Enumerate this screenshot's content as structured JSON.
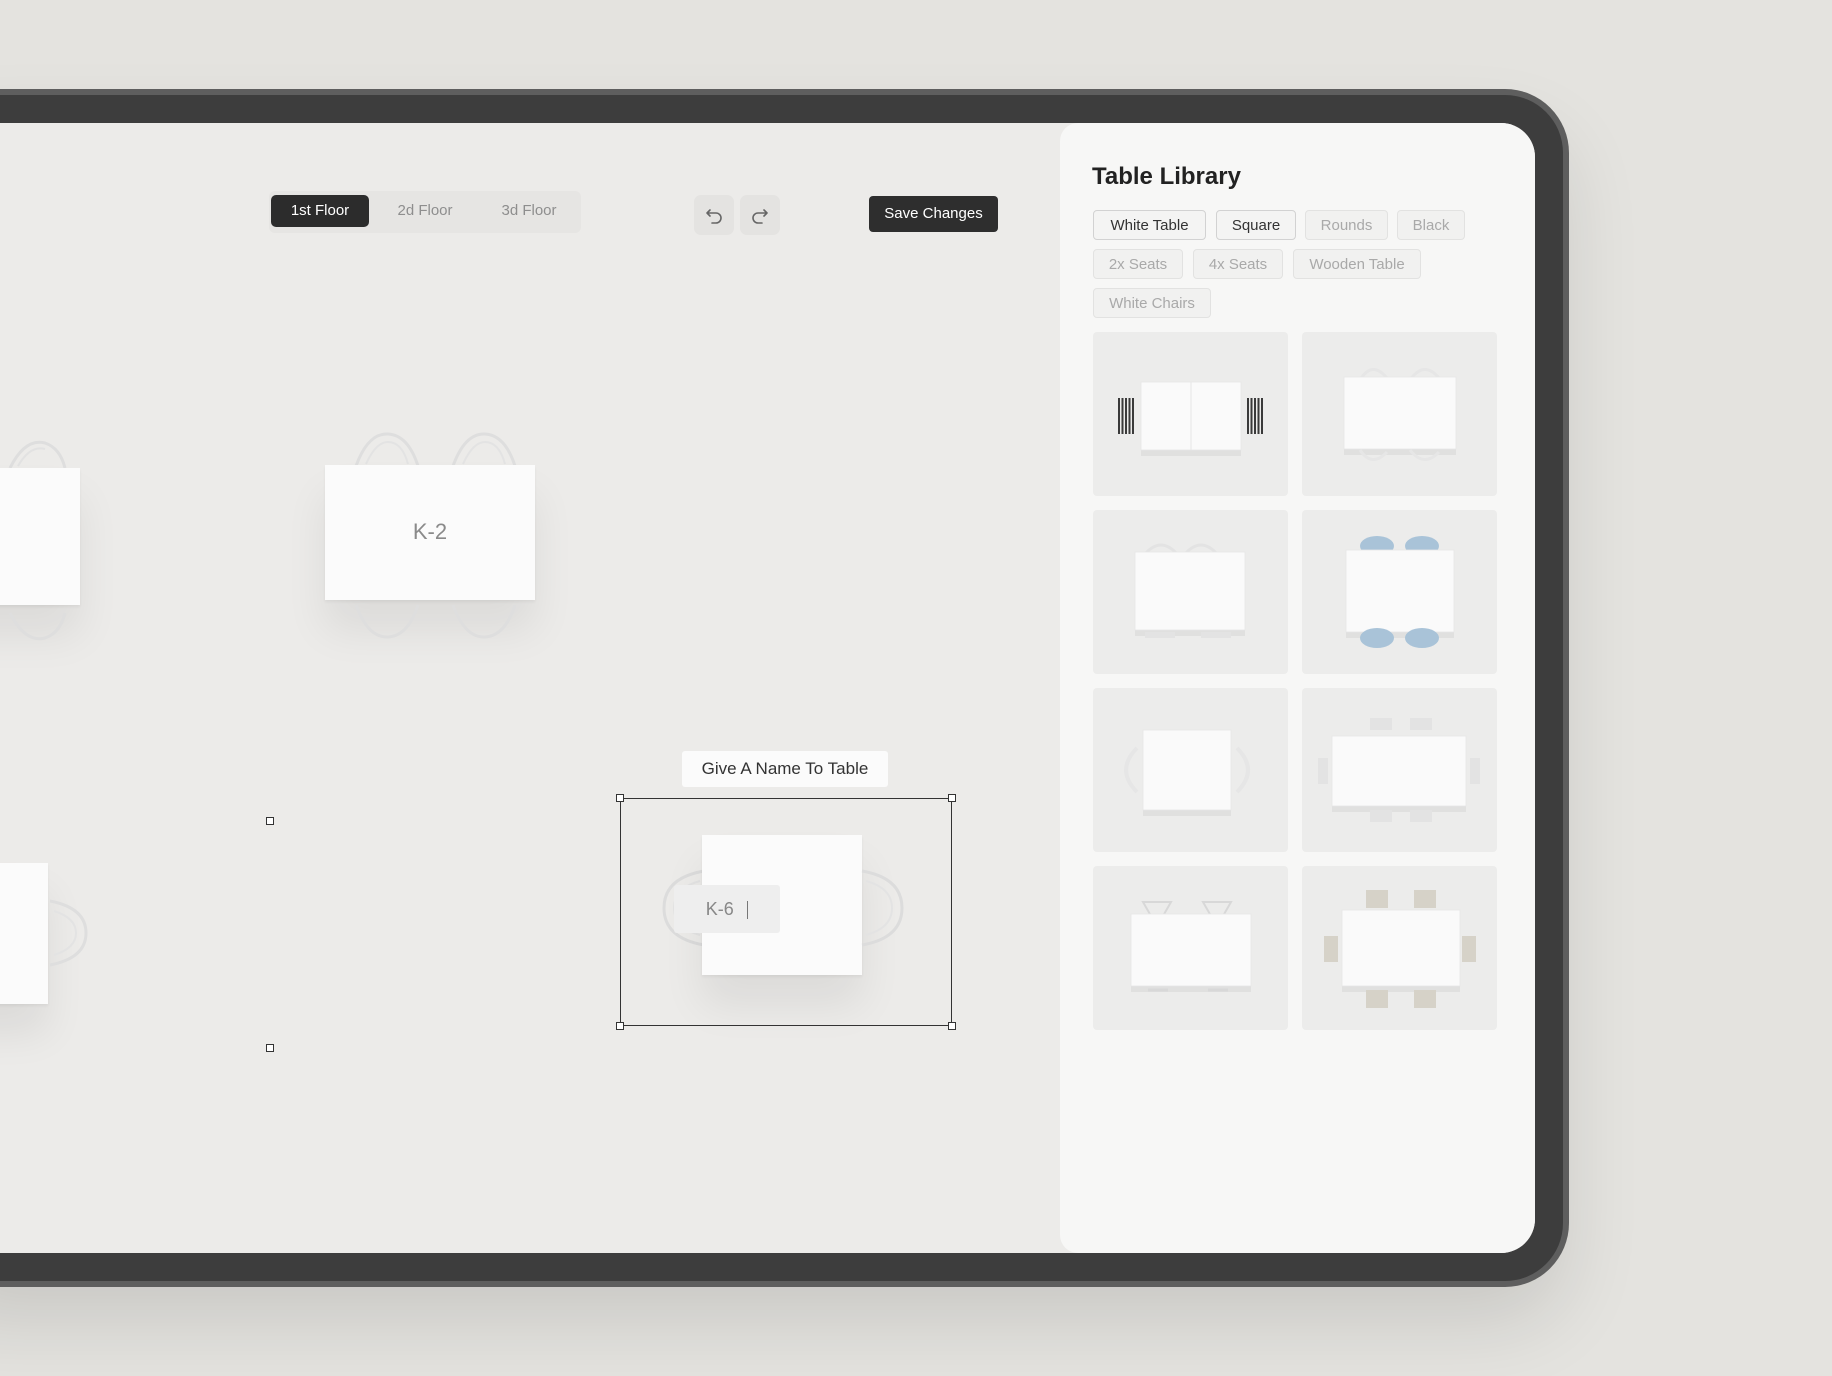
{
  "floor_tabs": [
    {
      "label": "1st Floor",
      "active": true
    },
    {
      "label": "2d Floor",
      "active": false
    },
    {
      "label": "3d Floor",
      "active": false
    }
  ],
  "toolbar": {
    "undo_icon": "undo-icon",
    "redo_icon": "redo-icon",
    "save_label": "Save Changes"
  },
  "canvas": {
    "tables": [
      {
        "label": "K-2"
      },
      {
        "label": ""
      },
      {
        "label": ""
      }
    ],
    "selected": {
      "tooltip": "Give A Name To Table",
      "input_value": "K-6"
    }
  },
  "library": {
    "title": "Table Library",
    "filters": [
      {
        "label": "White Table",
        "active": true
      },
      {
        "label": "Square",
        "active": true
      },
      {
        "label": "Rounds",
        "active": false
      },
      {
        "label": "Black",
        "active": false
      },
      {
        "label": "2x Seats",
        "active": false
      },
      {
        "label": "4x Seats",
        "active": false
      },
      {
        "label": "Wooden Table",
        "active": false
      },
      {
        "label": "White Chairs",
        "active": false
      }
    ],
    "items": [
      {
        "name": "table-black-side-chairs",
        "chair_color": "#3a3a3a"
      },
      {
        "name": "table-white-4-seats",
        "chair_color": "#e6e6e6"
      },
      {
        "name": "table-white-curved-chairs",
        "chair_color": "#e3e3e3"
      },
      {
        "name": "table-blue-chairs",
        "chair_color": "#a9c3d8"
      },
      {
        "name": "table-square-round-chairs",
        "chair_color": "#e6e6e6"
      },
      {
        "name": "table-6-seats",
        "chair_color": "#e3e3e3"
      },
      {
        "name": "table-wire-chairs",
        "chair_color": "#d8d8d8"
      },
      {
        "name": "table-wooden-chairs",
        "chair_color": "#d6d2c8"
      }
    ]
  }
}
